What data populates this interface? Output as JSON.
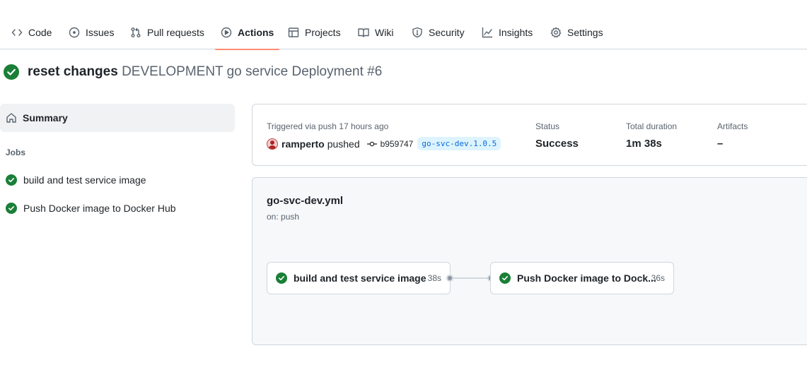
{
  "tabs": [
    {
      "label": "Code",
      "icon": "code-icon"
    },
    {
      "label": "Issues",
      "icon": "issue-opened-icon"
    },
    {
      "label": "Pull requests",
      "icon": "git-pull-request-icon"
    },
    {
      "label": "Actions",
      "icon": "play-icon",
      "selected": true
    },
    {
      "label": "Projects",
      "icon": "table-icon"
    },
    {
      "label": "Wiki",
      "icon": "book-icon"
    },
    {
      "label": "Security",
      "icon": "shield-icon"
    },
    {
      "label": "Insights",
      "icon": "graph-icon"
    },
    {
      "label": "Settings",
      "icon": "gear-icon"
    }
  ],
  "run": {
    "commit_message": "reset changes",
    "workflow_title": "DEVELOPMENT go service Deployment #6",
    "status_icon": "check-circle-fill-icon"
  },
  "sidebar": {
    "summary_label": "Summary",
    "jobs_heading": "Jobs",
    "jobs": [
      {
        "label": "build and test service image"
      },
      {
        "label": "Push Docker image to Docker Hub"
      }
    ]
  },
  "summary": {
    "trigger_text": "Triggered via push 17 hours ago",
    "actor": "ramperto",
    "action": "pushed",
    "commit_sha": "b959747",
    "ref": "go-svc-dev.1.0.5",
    "status_label": "Status",
    "status_value": "Success",
    "duration_label": "Total duration",
    "duration_value": "1m 38s",
    "artifacts_label": "Artifacts",
    "artifacts_value": "–"
  },
  "workflow": {
    "file_name": "go-svc-dev.yml",
    "trigger": "on: push",
    "jobs": [
      {
        "name": "build and test service image",
        "duration": "38s"
      },
      {
        "name": "Push Docker image to Dock...",
        "duration": "36s"
      }
    ]
  },
  "colors": {
    "success": "#1a7f37",
    "selected_tab_underline": "#fd8c73",
    "link": "#0969da"
  }
}
